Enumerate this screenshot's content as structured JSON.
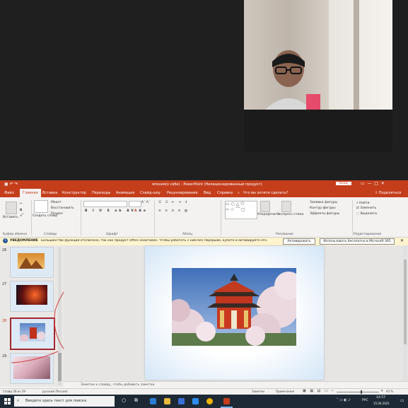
{
  "titlebar": {
    "window_title": "япония(о себе) - PowerPoint (Нелицензированный продукт)",
    "signin": "Вход"
  },
  "tabs": [
    "Файл",
    "Главная",
    "Вставка",
    "Конструктор",
    "Переходы",
    "Анимация",
    "Слайд-шоу",
    "Рецензирование",
    "Вид",
    "Справка",
    "Что вы хотите сделать?"
  ],
  "share_label": "Поделиться",
  "ribbon": {
    "groups": [
      "Буфер обмена",
      "Слайды",
      "Шрифт",
      "Абзац",
      "Рисование",
      "Редактирование"
    ],
    "paste_label": "Вставить",
    "slide_buttons": [
      "Макет",
      "Восстановить",
      "Раздел"
    ],
    "new_slide_label": "Создать слайд",
    "drawing_buttons": [
      "Заливка фигуры",
      "Контур фигуры",
      "Эффекты фигуры"
    ],
    "arrange_label": "Упорядочить",
    "styles_label": "Экспресс-стили",
    "find_label": "Найти",
    "replace_label": "Заменить",
    "select_label": "Выделить"
  },
  "notice": {
    "title": "УВЕДОМЛЕНИЕ",
    "message": "Большинство функций отключено, так как продукт Office неактивен. Чтобы работать с ним без перерыва, купите и активируйте его.",
    "buy_button": "Активировать",
    "trial_button": "Использовать бесплатно в Microsoft 365"
  },
  "thumbnails": [
    {
      "num": "26"
    },
    {
      "num": "27"
    },
    {
      "num": "28"
    },
    {
      "num": "29"
    }
  ],
  "notes_placeholder": "Заметки к слайду, чтобы добавить заметки",
  "status": {
    "slide_counter": "Слайд 28 из 29",
    "language": "русский (Россия)",
    "notes_button": "Заметки",
    "comments_button": "Примечания",
    "zoom": "63 %"
  },
  "taskbar": {
    "search_placeholder": "Введите здесь текст для поиска",
    "time": "14:57",
    "date": "15.04.2021",
    "lang": "РУС"
  },
  "colors": {
    "accent": "#c43e1c",
    "notice_bg": "#fff4ce",
    "taskbar": "#1d2a35"
  }
}
